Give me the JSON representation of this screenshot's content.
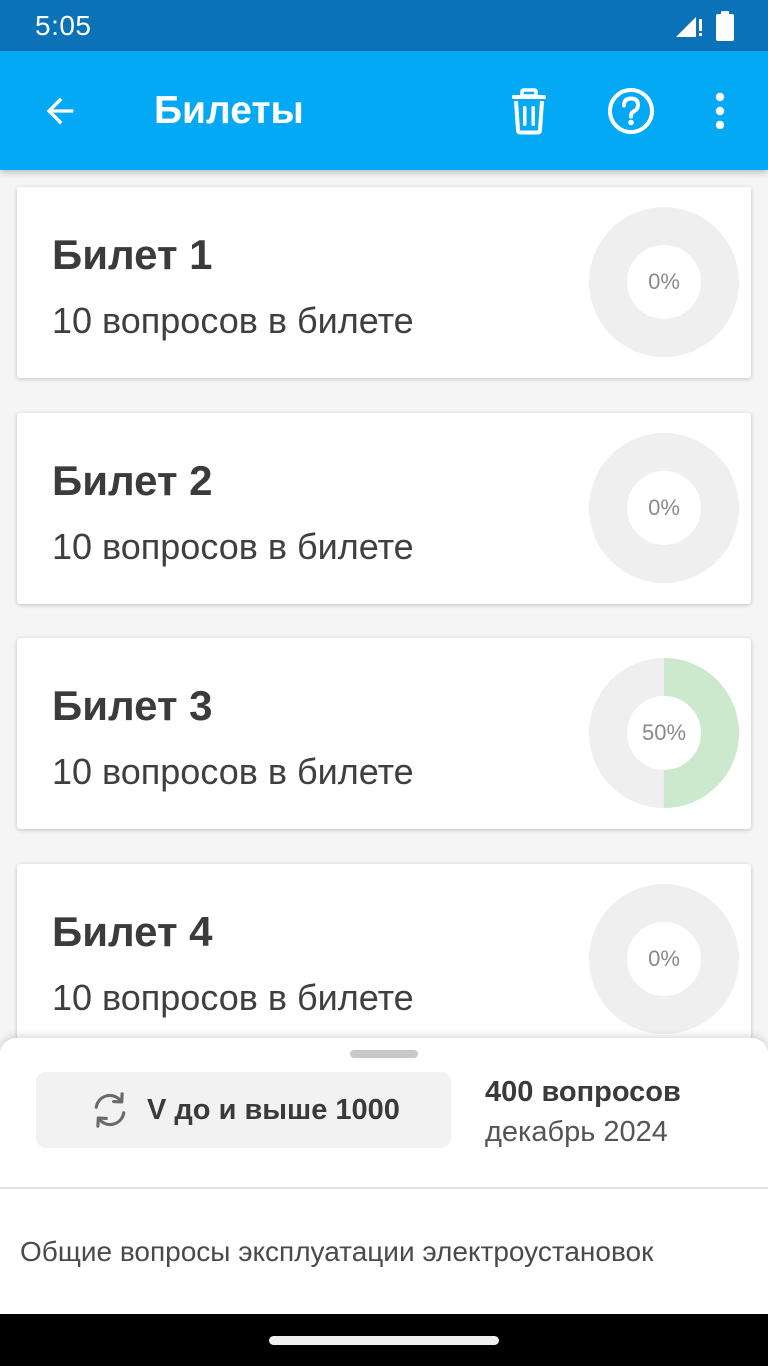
{
  "status_bar": {
    "time": "5:05",
    "icons": [
      "signal-icon",
      "battery-icon"
    ]
  },
  "app_bar": {
    "title": "Билеты",
    "icons": [
      "back-arrow-icon",
      "trash-icon",
      "help-circle-icon",
      "more-vert-icon"
    ],
    "background_color": "#03a9f4"
  },
  "tickets": [
    {
      "title": "Билет 1",
      "subtitle": "10 вопросов в билете",
      "progress_label": "0%",
      "progress": 0
    },
    {
      "title": "Билет 2",
      "subtitle": "10 вопросов в билете",
      "progress_label": "0%",
      "progress": 0
    },
    {
      "title": "Билет 3",
      "subtitle": "10 вопросов в билете",
      "progress_label": "50%",
      "progress": 0.5
    },
    {
      "title": "Билет 4",
      "subtitle": "10 вопросов в билете",
      "progress_label": "0%",
      "progress": 0
    }
  ],
  "colors": {
    "progress_track": "#efefef",
    "progress_fill": "#cce8cd"
  },
  "bottom_sheet": {
    "version_label": "V до и выше 1000",
    "version_icon": "sync-icon",
    "question_count": "400 вопросов",
    "date": "декабрь 2024",
    "category": "Общие вопросы эксплуатации электроустановок"
  }
}
